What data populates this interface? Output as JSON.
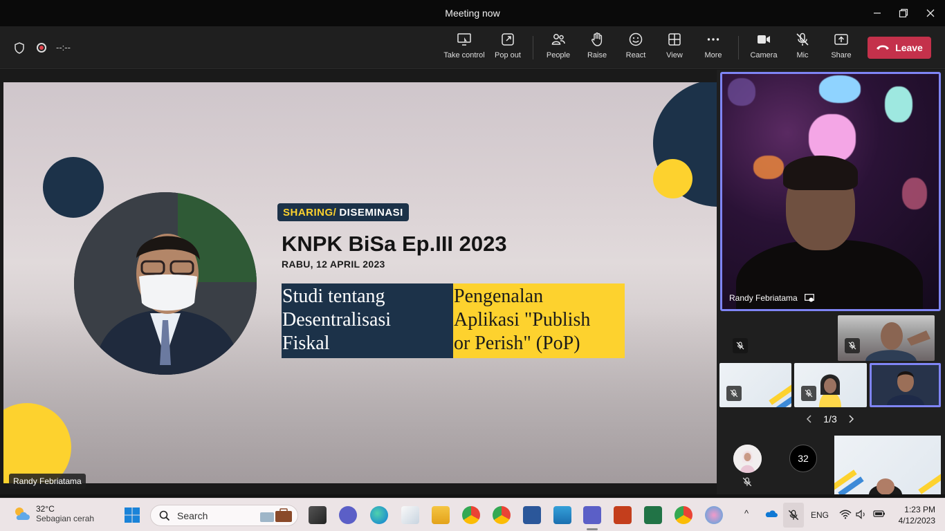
{
  "window": {
    "title": "Meeting now"
  },
  "toolbar": {
    "timer": "--:--",
    "buttons": [
      {
        "id": "take-control",
        "label": "Take control"
      },
      {
        "id": "pop-out",
        "label": "Pop out"
      },
      {
        "id": "people",
        "label": "People"
      },
      {
        "id": "raise",
        "label": "Raise"
      },
      {
        "id": "react",
        "label": "React"
      },
      {
        "id": "view",
        "label": "View"
      },
      {
        "id": "more",
        "label": "More"
      },
      {
        "id": "camera",
        "label": "Camera"
      },
      {
        "id": "mic",
        "label": "Mic"
      },
      {
        "id": "share",
        "label": "Share"
      }
    ],
    "leave_label": "Leave"
  },
  "slide": {
    "badge_highlight": "SHARING/",
    "badge_text": "DISEMINASI",
    "headline": "KNPK BiSa Ep.III 2023",
    "date": "RABU, 12 APRIL 2023",
    "box1_lines": [
      "Studi tentang",
      "Desentralisasi",
      "Fiskal"
    ],
    "box2_lines": [
      "Pengenalan",
      "Aplikasi \"Publish",
      "or Perish\" (PoP)"
    ],
    "presenter_name": "Randy Febriatama"
  },
  "participants": {
    "main_tile_name": "Randy Febriatama",
    "page": {
      "current": "1/3"
    },
    "overflow_count": "32"
  },
  "taskbar": {
    "weather_temp": "32°C",
    "weather_condition": "Sebagian cerah",
    "search_placeholder": "Search",
    "language": "ENG",
    "time": "1:23 PM",
    "date": "4/12/2023"
  },
  "colors": {
    "accent": "#7f85f5",
    "leave": "#c4314b",
    "slide_navy": "#1c3249",
    "slide_yellow": "#fdd22e"
  }
}
